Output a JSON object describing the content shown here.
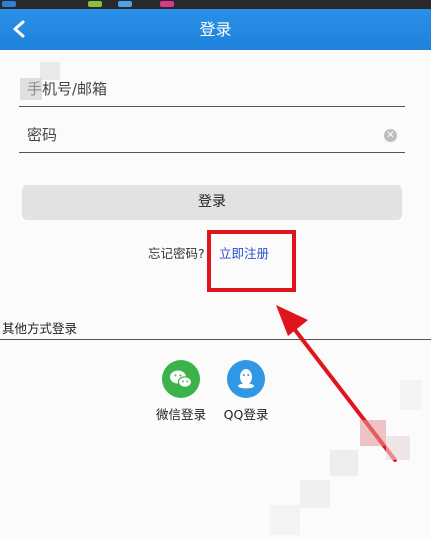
{
  "header": {
    "title": "登录",
    "back_icon": "chevron-left-icon"
  },
  "form": {
    "account_placeholder": "手机号/邮箱",
    "password_placeholder": "密码",
    "clear_icon": "clear-circle-icon",
    "login_label": "登录",
    "forgot_label": "忘记密码?",
    "register_label": "立即注册"
  },
  "other": {
    "title": "其他方式登录",
    "wechat_label": "微信登录",
    "qq_label": "QQ登录"
  },
  "colors": {
    "header": "#1f83dc",
    "wechat": "#3cb24a",
    "qq": "#2f97e3",
    "annotation": "#e0141c",
    "link": "#2a4fcf"
  }
}
